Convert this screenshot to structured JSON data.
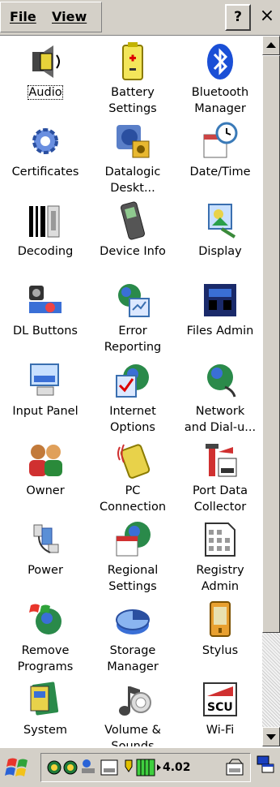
{
  "menu": {
    "file": "File",
    "view": "View"
  },
  "toolbar": {
    "help": "?",
    "close": "×"
  },
  "items": [
    {
      "label": "Audio",
      "icon": "audio-icon",
      "selected": true
    },
    {
      "label": "Battery\nSettings",
      "icon": "battery-icon"
    },
    {
      "label": "Bluetooth\nManager",
      "icon": "bluetooth-icon"
    },
    {
      "label": "Certificates",
      "icon": "certificates-icon"
    },
    {
      "label": "Datalogic\nDeskt...",
      "icon": "datalogic-desktop-icon"
    },
    {
      "label": "Date/Time",
      "icon": "date-time-icon"
    },
    {
      "label": "Decoding",
      "icon": "decoding-icon"
    },
    {
      "label": "Device Info",
      "icon": "device-info-icon"
    },
    {
      "label": "Display",
      "icon": "display-icon"
    },
    {
      "label": "DL Buttons",
      "icon": "dl-buttons-icon"
    },
    {
      "label": "Error\nReporting",
      "icon": "error-reporting-icon"
    },
    {
      "label": "Files Admin",
      "icon": "files-admin-icon"
    },
    {
      "label": "Input Panel",
      "icon": "input-panel-icon"
    },
    {
      "label": "Internet\nOptions",
      "icon": "internet-options-icon"
    },
    {
      "label": "Network\nand Dial-u...",
      "icon": "network-icon"
    },
    {
      "label": "Owner",
      "icon": "owner-icon"
    },
    {
      "label": "PC\nConnection",
      "icon": "pc-connection-icon"
    },
    {
      "label": "Port Data\nCollector",
      "icon": "port-data-collector-icon"
    },
    {
      "label": "Power",
      "icon": "power-icon"
    },
    {
      "label": "Regional\nSettings",
      "icon": "regional-settings-icon"
    },
    {
      "label": "Registry\nAdmin",
      "icon": "registry-admin-icon"
    },
    {
      "label": "Remove\nPrograms",
      "icon": "remove-programs-icon"
    },
    {
      "label": "Storage\nManager",
      "icon": "storage-manager-icon"
    },
    {
      "label": "Stylus",
      "icon": "stylus-icon"
    },
    {
      "label": "System",
      "icon": "system-icon"
    },
    {
      "label": "Volume &\nSounds",
      "icon": "volume-sounds-icon"
    },
    {
      "label": "Wi-Fi",
      "icon": "wifi-icon"
    }
  ],
  "taskbar": {
    "battery": "4.02"
  }
}
